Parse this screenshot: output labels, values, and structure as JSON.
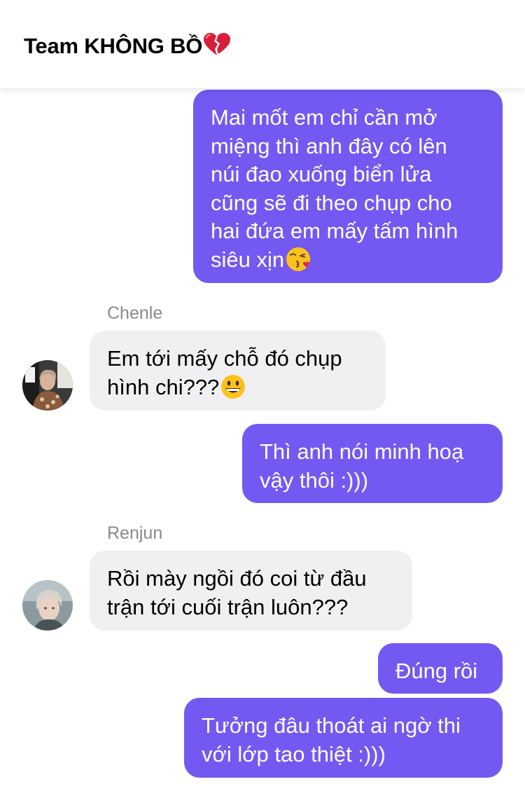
{
  "header": {
    "title": "Team KHÔNG BỒ",
    "title_icon": "broken-heart-icon"
  },
  "colors": {
    "outgoing_bubble": "#7359f1",
    "incoming_bubble": "#f0f0f2",
    "sender_name": "#8a8a8e"
  },
  "messages": [
    {
      "direction": "out",
      "lines": [
        "Mai mốt em chỉ cần mở",
        "miệng thì anh đây có lên",
        "núi đao xuống biển lửa",
        "cũng sẽ đi theo chụp cho",
        "hai đứa em mấy tấm hình",
        "siêu xịn"
      ],
      "emoji": "kissing-face-icon"
    },
    {
      "direction": "in",
      "sender": "Chenle",
      "lines": [
        "Em tới mấy chỗ đó chụp",
        "hình chi???"
      ],
      "emoji": "grinning-face-icon"
    },
    {
      "direction": "out",
      "lines": [
        "Thì anh nói minh hoạ",
        "vậy thôi :)))"
      ]
    },
    {
      "direction": "in",
      "sender": "Renjun",
      "lines": [
        "Rồi mày ngồi đó coi từ đầu",
        "trận tới cuối trận luôn???"
      ]
    },
    {
      "direction": "out",
      "lines": [
        "Đúng rồi"
      ]
    },
    {
      "direction": "out",
      "lines": [
        "Tưởng đâu thoát ai ngờ thi",
        "với lớp tao thiệt :)))"
      ]
    }
  ]
}
